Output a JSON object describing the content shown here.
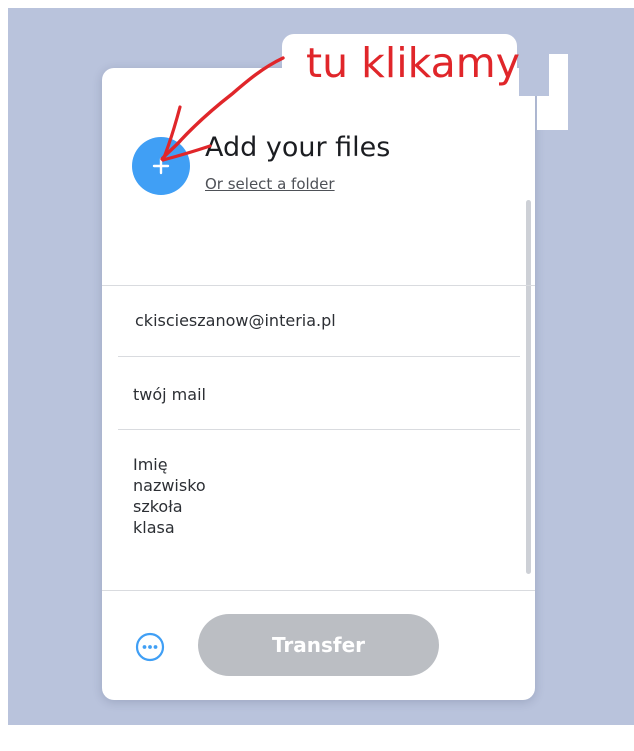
{
  "annotation": {
    "text": "tu klikamy",
    "color": "#e0262a"
  },
  "upload": {
    "title": "Add your files",
    "folder_link": "Or select a folder",
    "add_icon": "plus-icon",
    "accent": "#409ff5"
  },
  "form": {
    "recipient": "ckiscieszanow@interia.pl",
    "sender": "twój mail",
    "message_lines": [
      "Imię",
      "nazwisko",
      "szkoła",
      "klasa"
    ]
  },
  "footer": {
    "more_icon": "more-options-icon",
    "transfer_label": "Transfer"
  },
  "colors": {
    "background": "#b9c3dc",
    "transfer_disabled": "#bbbec3"
  }
}
